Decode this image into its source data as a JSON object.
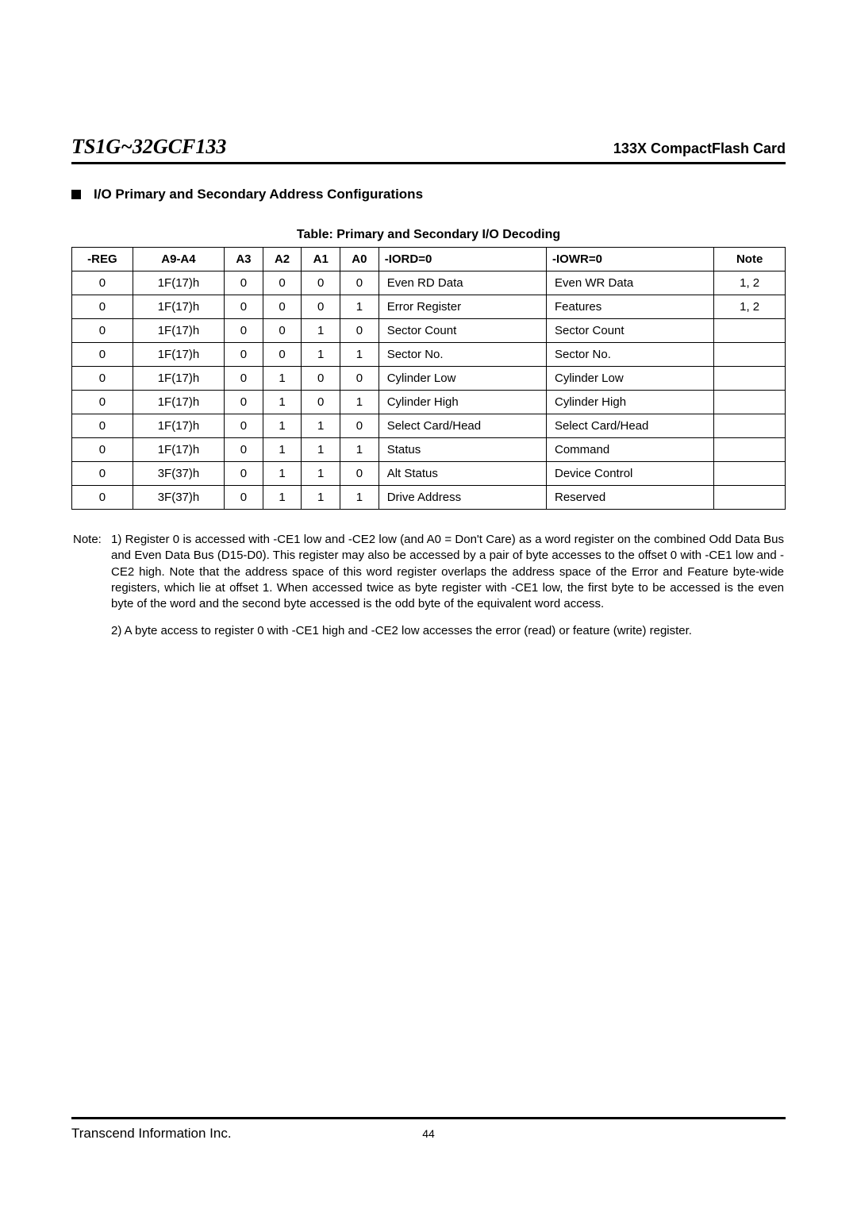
{
  "header": {
    "product_title": "TS1G~32GCF133",
    "product_subtitle": "133X CompactFlash Card"
  },
  "section": {
    "title": "I/O Primary and Secondary Address Configurations"
  },
  "table": {
    "title": "Table: Primary and Secondary I/O Decoding",
    "columns": [
      "-REG",
      "A9-A4",
      "A3",
      "A2",
      "A1",
      "A0",
      "-IORD=0",
      "-IOWR=0",
      "Note"
    ],
    "rows": [
      {
        "reg": "0",
        "addr": "1F(17)h",
        "a3": "0",
        "a2": "0",
        "a1": "0",
        "a0": "0",
        "iord": "Even RD Data",
        "iowr": "Even WR Data",
        "note": "1, 2"
      },
      {
        "reg": "0",
        "addr": "1F(17)h",
        "a3": "0",
        "a2": "0",
        "a1": "0",
        "a0": "1",
        "iord": "Error Register",
        "iowr": "Features",
        "note": "1, 2"
      },
      {
        "reg": "0",
        "addr": "1F(17)h",
        "a3": "0",
        "a2": "0",
        "a1": "1",
        "a0": "0",
        "iord": "Sector Count",
        "iowr": "Sector Count",
        "note": ""
      },
      {
        "reg": "0",
        "addr": "1F(17)h",
        "a3": "0",
        "a2": "0",
        "a1": "1",
        "a0": "1",
        "iord": "Sector No.",
        "iowr": "Sector No.",
        "note": ""
      },
      {
        "reg": "0",
        "addr": "1F(17)h",
        "a3": "0",
        "a2": "1",
        "a1": "0",
        "a0": "0",
        "iord": "Cylinder Low",
        "iowr": "Cylinder Low",
        "note": ""
      },
      {
        "reg": "0",
        "addr": "1F(17)h",
        "a3": "0",
        "a2": "1",
        "a1": "0",
        "a0": "1",
        "iord": "Cylinder High",
        "iowr": "Cylinder High",
        "note": ""
      },
      {
        "reg": "0",
        "addr": "1F(17)h",
        "a3": "0",
        "a2": "1",
        "a1": "1",
        "a0": "0",
        "iord": "Select Card/Head",
        "iowr": "Select Card/Head",
        "note": ""
      },
      {
        "reg": "0",
        "addr": "1F(17)h",
        "a3": "0",
        "a2": "1",
        "a1": "1",
        "a0": "1",
        "iord": "Status",
        "iowr": "Command",
        "note": ""
      },
      {
        "reg": "0",
        "addr": "3F(37)h",
        "a3": "0",
        "a2": "1",
        "a1": "1",
        "a0": "0",
        "iord": "Alt Status",
        "iowr": "Device Control",
        "note": ""
      },
      {
        "reg": "0",
        "addr": "3F(37)h",
        "a3": "0",
        "a2": "1",
        "a1": "1",
        "a0": "1",
        "iord": "Drive Address",
        "iowr": "Reserved",
        "note": ""
      }
    ]
  },
  "notes": {
    "label": "Note:",
    "note1": "1) Register 0 is accessed with -CE1 low and -CE2 low (and A0 = Don't Care) as a word register on the combined Odd Data Bus and Even Data Bus (D15-D0). This register may also be accessed by a pair of byte accesses to the offset 0 with -CE1 low and -CE2 high. Note that the address space of this word register overlaps the address space of the Error and Feature byte-wide registers, which lie at offset 1. When accessed twice as byte register with -CE1 low, the first byte to be accessed is the even byte of the word and the second byte accessed is the odd byte of the equivalent word access.",
    "note2": "2) A byte access to register 0 with -CE1 high and -CE2 low accesses the error (read) or feature (write) register."
  },
  "footer": {
    "company": "Transcend Information Inc.",
    "page_number": "44"
  }
}
